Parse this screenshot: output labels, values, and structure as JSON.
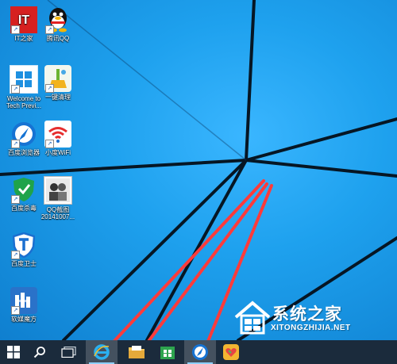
{
  "desktop_icons": [
    {
      "label": "IT之家",
      "icon": "it-home-icon"
    },
    {
      "label": "腾讯QQ",
      "icon": "qq-penguin-icon"
    },
    {
      "label": "Welcome to Tech Previ...",
      "icon": "windows-logo-icon"
    },
    {
      "label": "一键清理",
      "icon": "broom-clean-icon"
    },
    {
      "label": "百度浏览器",
      "icon": "baidu-browser-icon"
    },
    {
      "label": "小度WiFi",
      "icon": "wifi-icon"
    },
    {
      "label": "百度杀毒",
      "icon": "baidu-antivirus-shield-icon"
    },
    {
      "label": "QQ截图20141007...",
      "icon": "screenshot-thumbnail-icon"
    },
    {
      "label": "百度卫士",
      "icon": "baidu-guard-shield-icon"
    },
    {
      "label": "软媒魔方",
      "icon": "ruanmei-cube-icon"
    }
  ],
  "taskbar": {
    "start": "windows-start-icon",
    "search": "search-icon",
    "task_view": "task-view-icon",
    "pinned": [
      {
        "name": "internet-explorer",
        "icon": "ie-icon",
        "active": true
      },
      {
        "name": "file-explorer",
        "icon": "folder-icon",
        "active": false
      },
      {
        "name": "store",
        "icon": "store-icon",
        "active": false
      },
      {
        "name": "baidu-browser",
        "icon": "baidu-browser-icon",
        "active": true
      },
      {
        "name": "app-heart",
        "icon": "heart-icon",
        "active": false
      }
    ]
  },
  "watermark": {
    "title": "系统之家",
    "url": "XITONGZHIJIA.NET"
  },
  "colors": {
    "wallpaper": "#1ea1ee",
    "taskbar": "#1b2b3c",
    "arrows": "#ff3b3b"
  }
}
